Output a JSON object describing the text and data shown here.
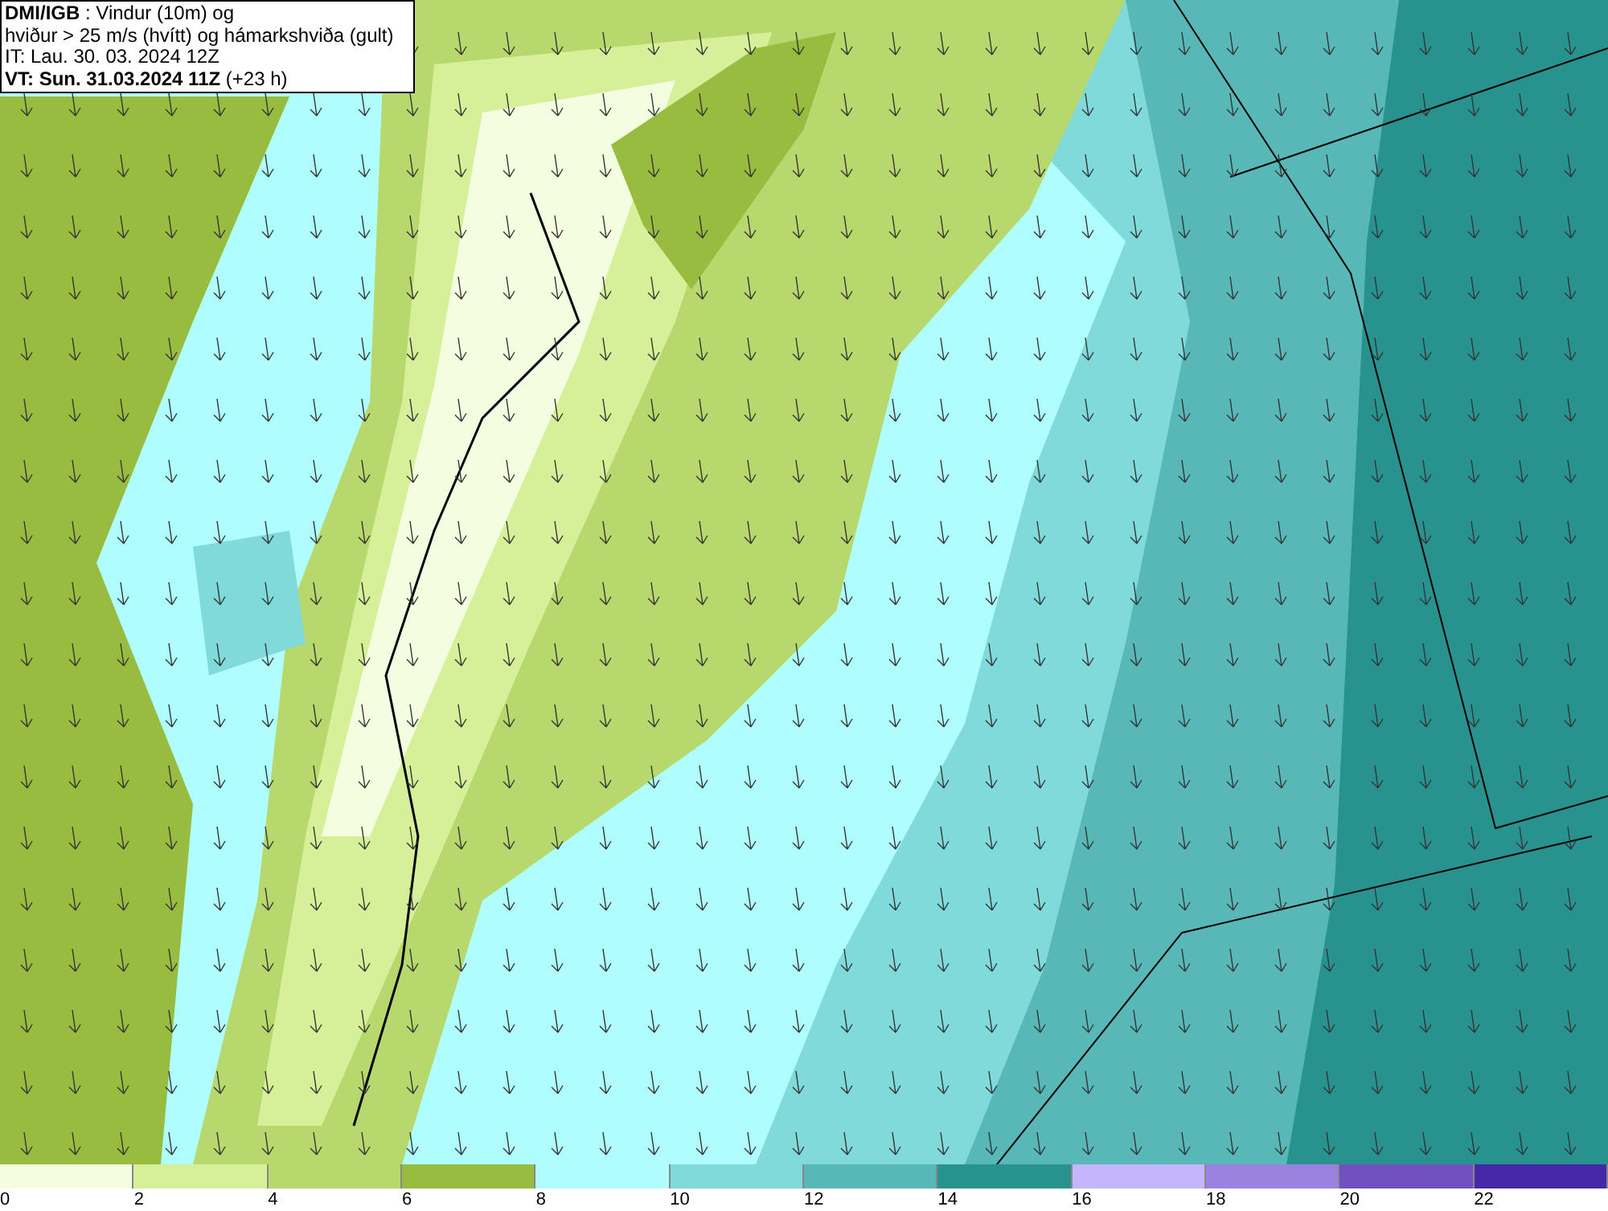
{
  "header": {
    "lines": [
      "**DMI/IGB** : Vindur (10m) og",
      "hviður > 25 m/s (hvítt) og hámarkshviða (gult)",
      "IT: Lau. 30. 03. 2024 12Z",
      "**VT: Sun. 31.03.2024 11Z** (+23 h)"
    ]
  },
  "legend": [
    {
      "label": "0",
      "color": "#f5fde0"
    },
    {
      "label": "2",
      "color": "#d6f09a"
    },
    {
      "label": "4",
      "color": "#b6d86c"
    },
    {
      "label": "6",
      "color": "#98bc40"
    },
    {
      "label": "8",
      "color": "#b0fdfd"
    },
    {
      "label": "10",
      "color": "#80dada"
    },
    {
      "label": "12",
      "color": "#58b8b8"
    },
    {
      "label": "14",
      "color": "#28938e"
    },
    {
      "label": "16",
      "color": "#c4b5fd"
    },
    {
      "label": "18",
      "color": "#9a83e0"
    },
    {
      "label": "20",
      "color": "#7150c0"
    },
    {
      "label": "22",
      "color": "#4428a8"
    }
  ]
}
